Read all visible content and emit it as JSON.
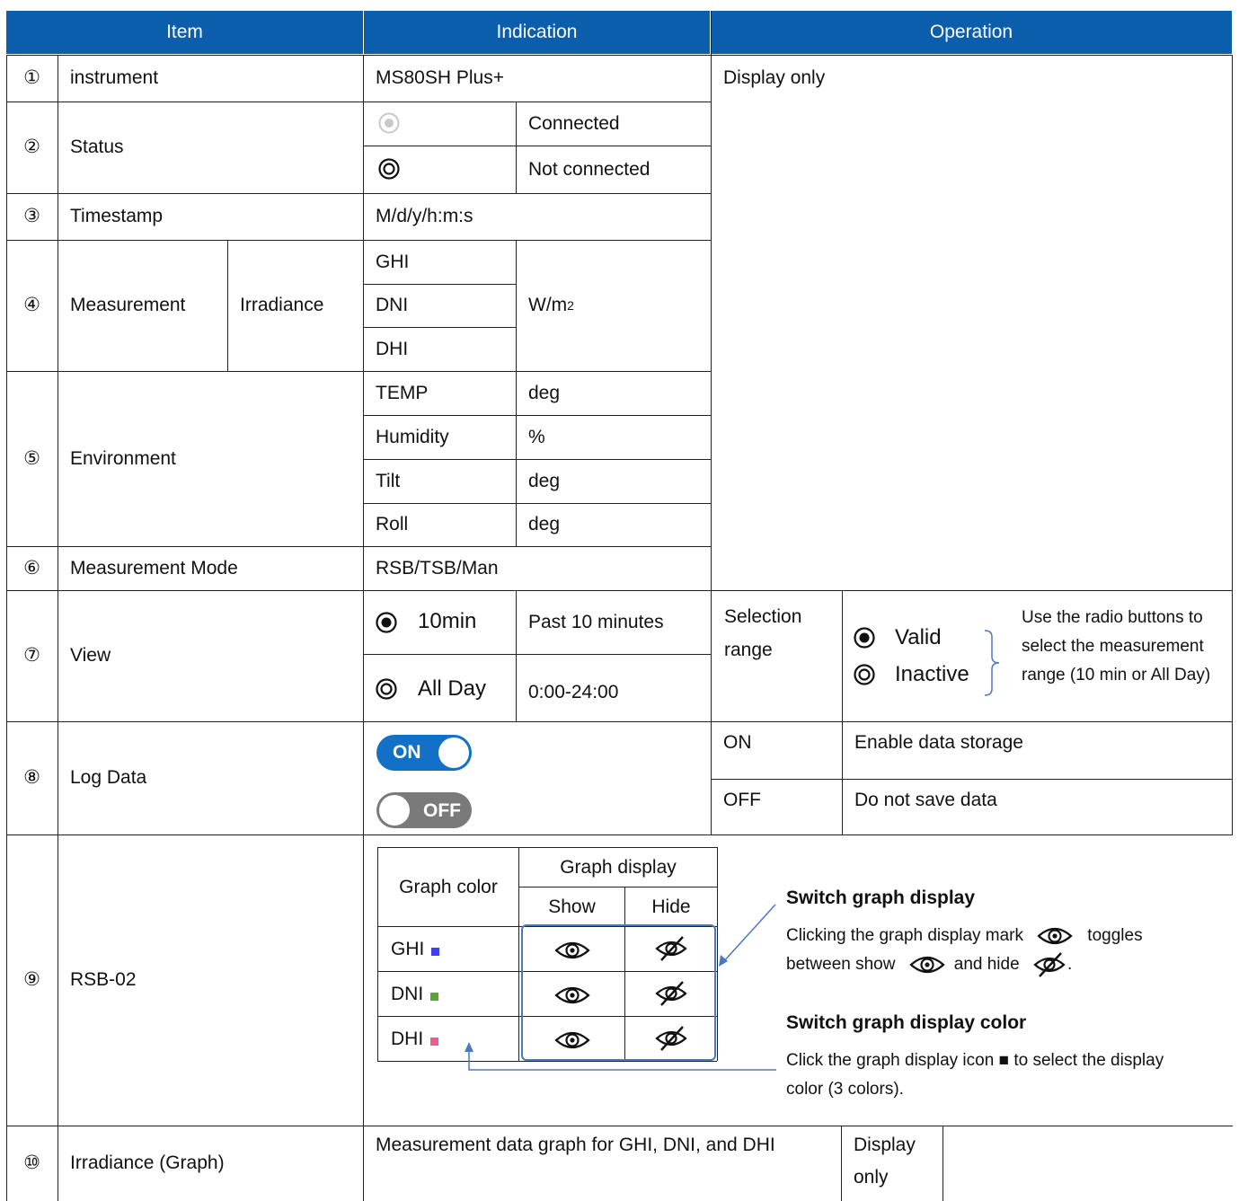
{
  "header": {
    "item": "Item",
    "indication": "Indication",
    "operation": "Operation"
  },
  "rows": {
    "r1": {
      "num": "①",
      "item": "instrument",
      "indication": "MS80SH Plus+",
      "operation": "Display only"
    },
    "r2": {
      "num": "②",
      "item": "Status",
      "connected": "Connected",
      "not_connected": "Not connected"
    },
    "r3": {
      "num": "③",
      "item": "Timestamp",
      "indication": "M/d/y/h:m:s"
    },
    "r4": {
      "num": "④",
      "item": "Measurement",
      "sub": "Irradiance",
      "ghi": "GHI",
      "dni": "DNI",
      "dhi": "DHI",
      "unit": "W/m",
      "unit_sup": "2"
    },
    "r5": {
      "num": "⑤",
      "item": "Environment",
      "params": [
        {
          "name": "TEMP",
          "unit": "deg"
        },
        {
          "name": "Humidity",
          "unit": "%"
        },
        {
          "name": "Tilt",
          "unit": "deg"
        },
        {
          "name": "Roll",
          "unit": "deg"
        }
      ]
    },
    "r6": {
      "num": "⑥",
      "item": "Measurement Mode",
      "indication": "RSB/TSB/Man"
    },
    "r7": {
      "num": "⑦",
      "item": "View",
      "opt1": "10min",
      "opt1_desc": "Past 10 minutes",
      "opt2": "All Day",
      "opt2_desc": "0:00-24:00",
      "sel_label": "Selection range",
      "valid": "Valid",
      "inactive": "Inactive",
      "note": "Use the radio buttons to select the measurement range (10 min or All Day)"
    },
    "r8": {
      "num": "⑧",
      "item": "Log Data",
      "on": "ON",
      "off": "OFF",
      "on_desc": "Enable data storage",
      "off_desc": "Do not save data"
    },
    "r9": {
      "num": "⑨",
      "item": "RSB-02",
      "graph_color": "Graph color",
      "graph_display": "Graph display",
      "show": "Show",
      "hide": "Hide",
      "series": [
        {
          "name": "GHI",
          "color": "#3f3ff0"
        },
        {
          "name": "DNI",
          "color": "#5aa33b"
        },
        {
          "name": "DHI",
          "color": "#e8608e"
        }
      ],
      "switch_title": "Switch graph display",
      "switch_text1": "Clicking the graph display mark",
      "switch_text2": "toggles",
      "switch_text3": "between show",
      "switch_text4": "and hide",
      "switch_text5": ".",
      "color_title": "Switch graph display color",
      "color_text1": "Click the graph display icon ■ to select the display",
      "color_text2": "color (3 colors)."
    },
    "r10": {
      "num": "⑩",
      "item": "Irradiance (Graph)",
      "indication": "Measurement data graph for GHI, DNI, and DHI",
      "operation": "Display only"
    }
  },
  "colors": {
    "header_bg": "#0b5eac",
    "toggle_on": "#1270c7",
    "toggle_off": "#7a7a7a",
    "callout_line": "#4a78c2"
  }
}
